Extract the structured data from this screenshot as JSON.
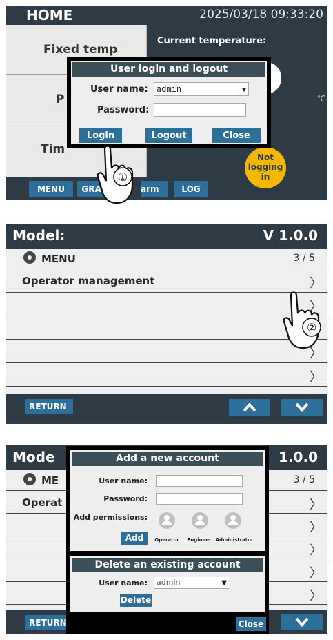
{
  "screen1": {
    "title": "HOME",
    "datetime": "2025/03/18  09:33:20",
    "left_items": [
      "Fixed temp",
      "P",
      "Tim"
    ],
    "current_temperature_label": "Current temperature:",
    "unit": "℃",
    "status_badge": "Not logging in",
    "bottom_buttons": [
      "MENU",
      "GRAP",
      "arm",
      "LOG"
    ],
    "dialog": {
      "title": "User login and logout",
      "username_label": "User name:",
      "username_value": "admin",
      "password_label": "Password:",
      "login": "Login",
      "logout": "Logout",
      "close": "Close"
    },
    "step": "①"
  },
  "screen2": {
    "model_label": "Model:",
    "version": "V 1.0.0",
    "menu_label": "MENU",
    "page": "3 / 5",
    "items": [
      "Operator management",
      "",
      "",
      "",
      ""
    ],
    "return_label": "RETURN",
    "step": "②"
  },
  "screen3": {
    "model_label": "Mode",
    "version": "1.0.0",
    "menu_label": "ME",
    "page": "3 / 5",
    "first_item": "Operat",
    "return_label": "RETURN",
    "add_panel": {
      "title": "Add a new account",
      "username_label": "User name:",
      "password_label": "Password:",
      "permissions_label": "Add permissions:",
      "add_button": "Add",
      "roles": [
        "Operator",
        "Engineer",
        "Administrator"
      ]
    },
    "delete_panel": {
      "title": "Delete an existing account",
      "username_label": "User name:",
      "username_value": "admin",
      "delete_button": "Delete"
    },
    "close": "Close"
  }
}
